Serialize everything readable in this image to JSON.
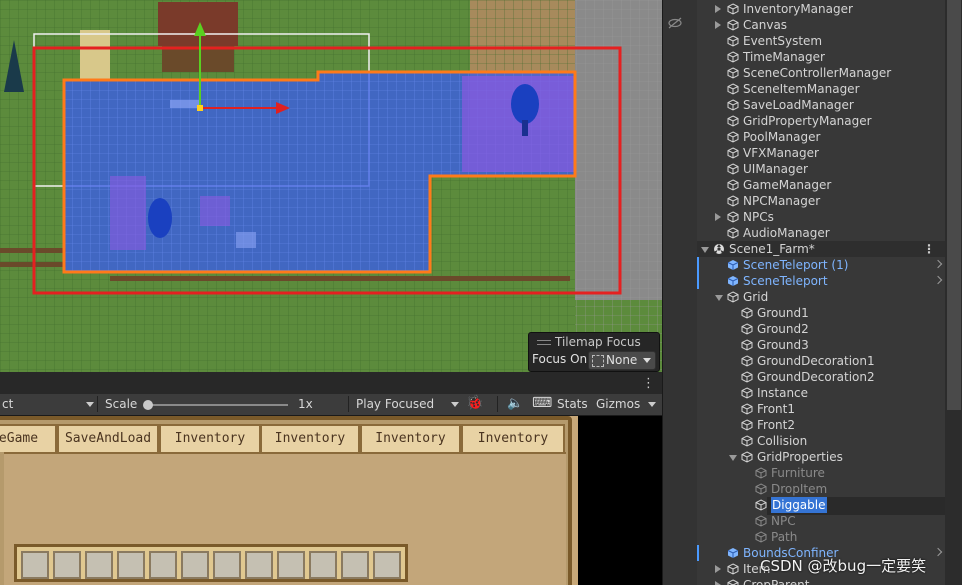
{
  "scene_view": {
    "tilemap_focus": {
      "title": "Tilemap Focus",
      "focus_label": "Focus On",
      "focus_value": "None"
    }
  },
  "game_toolbar": {
    "display_fragment": "ct",
    "scale_label": "Scale",
    "scale_value": "1x",
    "play_mode": "Play Focused",
    "stats_label": "Stats",
    "gizmos_label": "Gizmos"
  },
  "game_view": {
    "tabs": [
      "eGame",
      "SaveAndLoad",
      "Inventory",
      "Inventory",
      "Inventory",
      "Inventory"
    ],
    "slot_count": 12
  },
  "hierarchy": {
    "items": [
      {
        "label": "InventoryManager",
        "expander": "right"
      },
      {
        "label": "Canvas",
        "expander": "right"
      },
      {
        "label": "EventSystem",
        "expander": "none"
      },
      {
        "label": "TimeManager",
        "expander": "none"
      },
      {
        "label": "SceneControllerManager",
        "expander": "none"
      },
      {
        "label": "SceneItemManager",
        "expander": "none"
      },
      {
        "label": "SaveLoadManager",
        "expander": "none"
      },
      {
        "label": "GridPropertyManager",
        "expander": "none"
      },
      {
        "label": "PoolManager",
        "expander": "none"
      },
      {
        "label": "VFXManager",
        "expander": "none"
      },
      {
        "label": "UIManager",
        "expander": "none"
      },
      {
        "label": "GameManager",
        "expander": "none"
      },
      {
        "label": "NPCManager",
        "expander": "none"
      },
      {
        "label": "NPCs",
        "expander": "right"
      },
      {
        "label": "AudioManager",
        "expander": "none"
      },
      {
        "label": "Scene1_Farm*",
        "expander": "down",
        "type": "scene"
      },
      {
        "label": "SceneTeleport (1)",
        "expander": "none",
        "type": "prefab"
      },
      {
        "label": "SceneTeleport",
        "expander": "none",
        "type": "prefab"
      },
      {
        "label": "Grid",
        "expander": "down"
      },
      {
        "label": "Ground1",
        "expander": "none"
      },
      {
        "label": "Ground2",
        "expander": "none"
      },
      {
        "label": "Ground3",
        "expander": "none"
      },
      {
        "label": "GroundDecoration1",
        "expander": "none"
      },
      {
        "label": "GroundDecoration2",
        "expander": "none"
      },
      {
        "label": "Instance",
        "expander": "none"
      },
      {
        "label": "Front1",
        "expander": "none"
      },
      {
        "label": "Front2",
        "expander": "none"
      },
      {
        "label": "Collision",
        "expander": "none"
      },
      {
        "label": "GridProperties",
        "expander": "down"
      },
      {
        "label": "Furniture",
        "expander": "none",
        "type": "disabled"
      },
      {
        "label": "DropItem",
        "expander": "none",
        "type": "disabled"
      },
      {
        "label": "Diggable",
        "expander": "none",
        "type": "selected"
      },
      {
        "label": "NPC",
        "expander": "none",
        "type": "disabled"
      },
      {
        "label": "Path",
        "expander": "none",
        "type": "disabled"
      },
      {
        "label": "BoundsConfiner",
        "expander": "none",
        "type": "prefab"
      },
      {
        "label": "Item",
        "expander": "right"
      },
      {
        "label": "CropParent",
        "expander": "right"
      }
    ]
  },
  "watermark": "CSDN @改bug一定要笑",
  "colors": {
    "selection": "#3574d4",
    "prefab_text": "#7fb5ff",
    "tilemap_overlay": "#3a5ee8",
    "bounds_red": "#e52020",
    "bounds_orange": "#ff7a1a"
  }
}
